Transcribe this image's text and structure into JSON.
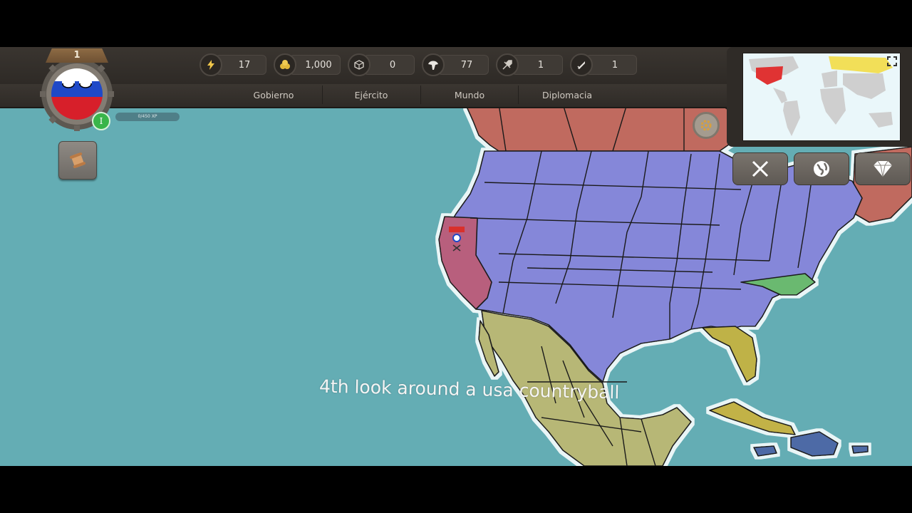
{
  "player": {
    "level": "1",
    "xp": "0/450 XP",
    "rank": "I",
    "country_ball": "russia-countryball"
  },
  "resources": [
    {
      "name": "energy",
      "icon": "lightning-icon",
      "value": "17"
    },
    {
      "name": "money",
      "icon": "coins-icon",
      "value": "1,000"
    },
    {
      "name": "materials",
      "icon": "cube-icon",
      "value": "0"
    },
    {
      "name": "military",
      "icon": "helmet-icon",
      "value": "77"
    },
    {
      "name": "aircraft",
      "icon": "jet-icon",
      "value": "1"
    },
    {
      "name": "missiles",
      "icon": "missile-icon",
      "value": "1"
    }
  ],
  "tabs": [
    "Gobierno",
    "Ejército",
    "Mundo",
    "Diplomacia"
  ],
  "side_buttons": [
    "battle-swords-icon",
    "globe-icon",
    "diamond-icon"
  ],
  "subtitle": "4th look around a usa countryball",
  "colors": {
    "ocean": "#64adb4",
    "usa": "#8587d9",
    "canada": "#c06a5e",
    "mexico": "#b7b776",
    "california": "#b85e7d",
    "north_carolina": "#6bb96f",
    "florida": "#bfb247",
    "cuba": "#c2b247",
    "hispaniola": "#4e6aa6",
    "jamaica": "#4e6aa6"
  }
}
